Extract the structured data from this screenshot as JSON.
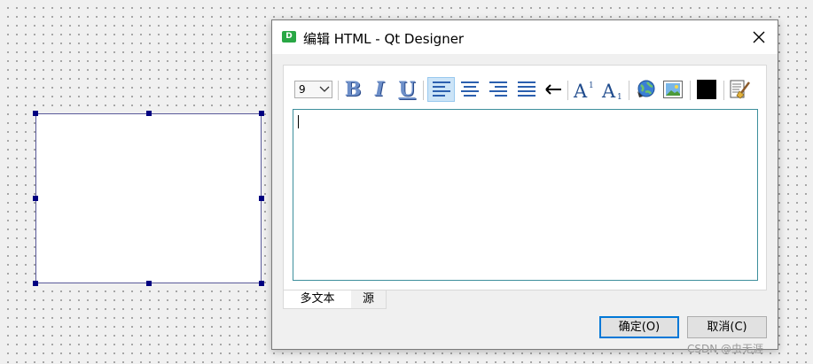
{
  "dialog": {
    "title": "编辑 HTML - Qt Designer",
    "app_icon_letter": "D",
    "close_icon": "close-icon"
  },
  "toolbar": {
    "font_size": "9",
    "bold_label": "B",
    "italic_label": "I",
    "underline_label": "U",
    "align_active": "left",
    "text_color": "#000000",
    "icons": [
      "align-left-icon",
      "align-center-icon",
      "align-right-icon",
      "align-justify-icon",
      "direction-arrow-icon",
      "superscript-icon",
      "subscript-icon",
      "insert-link-icon",
      "insert-image-icon",
      "text-color-icon",
      "simplify-html-icon"
    ]
  },
  "tabs": [
    {
      "label": "多文本",
      "active": true
    },
    {
      "label": "源",
      "active": false
    }
  ],
  "buttons": {
    "ok": "确定(O)",
    "cancel": "取消(C)"
  },
  "watermark": "CSDN @虫无涯",
  "colors": {
    "accent": "#0078d7",
    "editor_border": "#3d8f9c",
    "handle": "#000080"
  }
}
